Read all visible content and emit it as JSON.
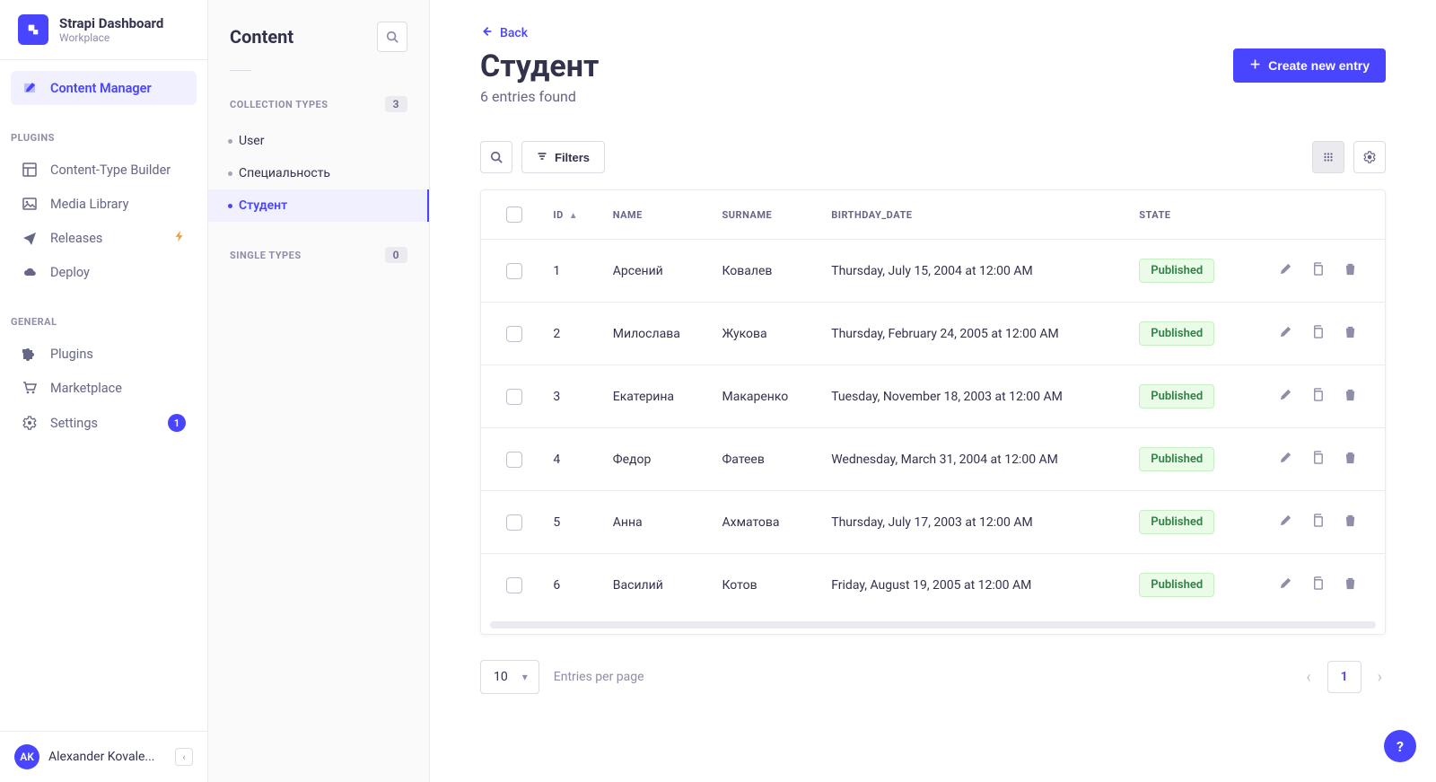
{
  "brand": {
    "title": "Strapi Dashboard",
    "subtitle": "Workplace"
  },
  "nav": {
    "content_manager": "Content Manager",
    "plugins_heading": "PLUGINS",
    "ctb": "Content-Type Builder",
    "media_library": "Media Library",
    "releases": "Releases",
    "deploy": "Deploy",
    "general_heading": "GENERAL",
    "plugins": "Plugins",
    "marketplace": "Marketplace",
    "settings": "Settings",
    "settings_badge": "1"
  },
  "user": {
    "initials": "AK",
    "name": "Alexander Kovale..."
  },
  "content_sidebar": {
    "title": "Content",
    "collection_types": "COLLECTION TYPES",
    "collection_count": "3",
    "items": [
      "User",
      "Специальность",
      "Студент"
    ],
    "single_types": "SINGLE TYPES",
    "single_count": "0"
  },
  "page": {
    "back": "Back",
    "title": "Студент",
    "subtitle": "6 entries found",
    "create_label": "Create new entry",
    "filters": "Filters"
  },
  "table": {
    "headers": {
      "id": "ID",
      "name": "NAME",
      "surname": "SURNAME",
      "birthday": "BIRTHDAY_DATE",
      "state": "STATE"
    },
    "rows": [
      {
        "id": "1",
        "name": "Арсений",
        "surname": "Ковалев",
        "birthday": "Thursday, July 15, 2004 at 12:00 AM",
        "state": "Published"
      },
      {
        "id": "2",
        "name": "Милослава",
        "surname": "Жукова",
        "birthday": "Thursday, February 24, 2005 at 12:00 AM",
        "state": "Published"
      },
      {
        "id": "3",
        "name": "Екатерина",
        "surname": "Макаренко",
        "birthday": "Tuesday, November 18, 2003 at 12:00 AM",
        "state": "Published"
      },
      {
        "id": "4",
        "name": "Федор",
        "surname": "Фатеев",
        "birthday": "Wednesday, March 31, 2004 at 12:00 AM",
        "state": "Published"
      },
      {
        "id": "5",
        "name": "Анна",
        "surname": "Ахматова",
        "birthday": "Thursday, July 17, 2003 at 12:00 AM",
        "state": "Published"
      },
      {
        "id": "6",
        "name": "Василий",
        "surname": "Котов",
        "birthday": "Friday, August 19, 2005 at 12:00 AM",
        "state": "Published"
      }
    ]
  },
  "pagination": {
    "page_size": "10",
    "label": "Entries per page",
    "current": "1"
  },
  "help": "?"
}
